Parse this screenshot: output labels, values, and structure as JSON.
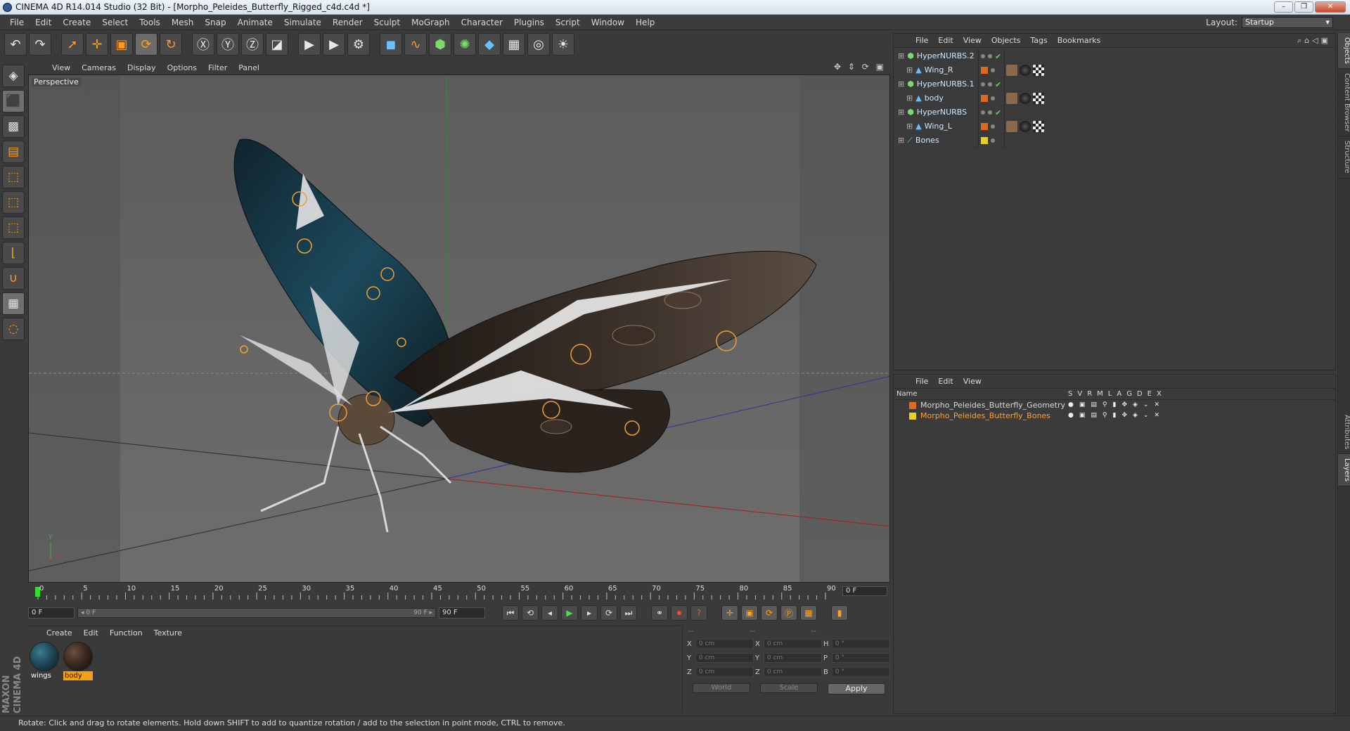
{
  "title": "CINEMA 4D R14.014 Studio (32 Bit) - [Morpho_Peleides_Butterfly_Rigged_c4d.c4d *]",
  "window_buttons": [
    "–",
    "❐",
    "✕"
  ],
  "menu": [
    "File",
    "Edit",
    "Create",
    "Select",
    "Tools",
    "Mesh",
    "Snap",
    "Animate",
    "Simulate",
    "Render",
    "Sculpt",
    "MoGraph",
    "Character",
    "Plugins",
    "Script",
    "Window",
    "Help"
  ],
  "layout": {
    "label": "Layout:",
    "value": "Startup"
  },
  "viewport": {
    "menu": [
      "View",
      "Cameras",
      "Display",
      "Options",
      "Filter",
      "Panel"
    ],
    "label": "Perspective",
    "nav_icons": "✥ ⇕ ⟳ ▣"
  },
  "timeline": {
    "ticks": [
      "0",
      "5",
      "10",
      "15",
      "20",
      "25",
      "30",
      "35",
      "40",
      "45",
      "50",
      "55",
      "60",
      "65",
      "70",
      "75",
      "80",
      "85",
      "90"
    ],
    "current_frame": "0 F"
  },
  "transport": {
    "start": "0 F",
    "slider_left": "◂ 0 F",
    "slider_right": "90 F ▸",
    "end": "90 F"
  },
  "materials": {
    "menu": [
      "Create",
      "Edit",
      "Function",
      "Texture"
    ],
    "items": [
      {
        "name": "wings",
        "color": "#1f4a5a"
      },
      {
        "name": "body",
        "color": "#3a2a1e"
      }
    ]
  },
  "coords": {
    "head": [
      "--",
      "--",
      "--"
    ],
    "rows": [
      {
        "a1": "X",
        "v1": "0 cm",
        "a2": "X",
        "v2": "0 cm",
        "a3": "H",
        "v3": "0 °"
      },
      {
        "a1": "Y",
        "v1": "0 cm",
        "a2": "Y",
        "v2": "0 cm",
        "a3": "P",
        "v3": "0 °"
      },
      {
        "a1": "Z",
        "v1": "0 cm",
        "a2": "Z",
        "v2": "0 cm",
        "a3": "B",
        "v3": "0 °"
      }
    ],
    "world": "World",
    "scale": "Scale",
    "apply": "Apply"
  },
  "objects_panel": {
    "menu": [
      "File",
      "Edit",
      "View",
      "Objects",
      "Tags",
      "Bookmarks"
    ],
    "rows": [
      {
        "name": "HyperNURBS.2",
        "indent": 0,
        "color": "#cfe8ff",
        "swatch": "",
        "check": "✔",
        "tags": false
      },
      {
        "name": "Wing_R",
        "indent": 1,
        "color": "#cfe8ff",
        "swatch": "#e06a20",
        "check": "",
        "tags": true
      },
      {
        "name": "HyperNURBS.1",
        "indent": 0,
        "color": "#cfe8ff",
        "swatch": "",
        "check": "✔",
        "tags": false
      },
      {
        "name": "body",
        "indent": 1,
        "color": "#cfe8ff",
        "swatch": "#e06a20",
        "check": "",
        "tags": true
      },
      {
        "name": "HyperNURBS",
        "indent": 0,
        "color": "#cfe8ff",
        "swatch": "",
        "check": "✔",
        "tags": false
      },
      {
        "name": "Wing_L",
        "indent": 1,
        "color": "#cfe8ff",
        "swatch": "#e06a20",
        "check": "",
        "tags": true
      },
      {
        "name": "Bones",
        "indent": 0,
        "color": "#cfe8ff",
        "swatch": "#e8d020",
        "check": "",
        "tags": false
      }
    ]
  },
  "layers_panel": {
    "menu": [
      "File",
      "Edit",
      "View"
    ],
    "header": "Name",
    "cols": [
      "S",
      "V",
      "R",
      "M",
      "L",
      "A",
      "G",
      "D",
      "E",
      "X"
    ],
    "rows": [
      {
        "name": "Morpho_Peleides_Butterfly_Geometry",
        "color": "#e06a20",
        "text_color": "#d8d8d8"
      },
      {
        "name": "Morpho_Peleides_Butterfly_Bones",
        "color": "#e8d020",
        "text_color": "#ffa030"
      }
    ]
  },
  "right_tabs": [
    "Objects",
    "Content Browser",
    "Structure",
    "Attributes",
    "Layers"
  ],
  "status": "Rotate: Click and drag to rotate elements. Hold down SHIFT to add to quantize rotation / add to the selection in point mode, CTRL to remove.",
  "brand": "MAXON CINEMA 4D"
}
